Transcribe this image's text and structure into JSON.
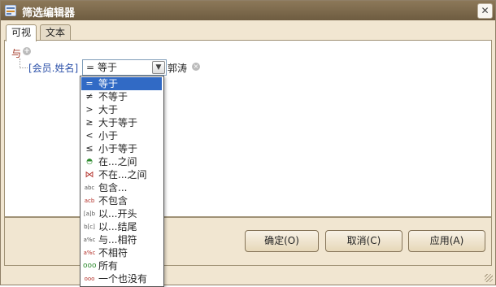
{
  "window": {
    "title": "筛选编辑器",
    "close_glyph": "✕"
  },
  "tabs": [
    {
      "label": "可视"
    },
    {
      "label": "文本"
    }
  ],
  "filter": {
    "group_operator": "与",
    "add_glyph": "+",
    "condition": {
      "field": "[会员.姓名]",
      "operator_icon": "=",
      "operator": "等于",
      "value": "郭涛",
      "clear_glyph": "×"
    }
  },
  "operator_options": [
    {
      "icon": "=",
      "label": "等于",
      "selected": true
    },
    {
      "icon": "≠",
      "label": "不等于"
    },
    {
      "icon": ">",
      "label": "大于"
    },
    {
      "icon": "≥",
      "label": "大于等于"
    },
    {
      "icon": "<",
      "label": "小于"
    },
    {
      "icon": "≤",
      "label": "小于等于"
    },
    {
      "icon": "◓",
      "label": "在...之间"
    },
    {
      "icon": "⋈",
      "label": "不在...之间"
    },
    {
      "icon": "abc",
      "label": "包含..."
    },
    {
      "icon": "acb",
      "label": "不包含"
    },
    {
      "icon": "[a]b",
      "label": "以...开头"
    },
    {
      "icon": "b[c]",
      "label": "以...结尾"
    },
    {
      "icon": "a%c",
      "label": "与...相符"
    },
    {
      "icon": "a%c",
      "label": "不相符"
    },
    {
      "icon": "ooo",
      "label": "所有"
    },
    {
      "icon": "ooo",
      "label": "一个也没有"
    }
  ],
  "buttons": {
    "ok": "确定(O)",
    "cancel": "取消(C)",
    "apply": "应用(A)"
  },
  "colors": {
    "titlebar": "#7a6749",
    "frame": "#f1e6d1",
    "selection": "#316ac5",
    "field_link": "#2a4fa8",
    "group_operator": "#a33b2a"
  }
}
